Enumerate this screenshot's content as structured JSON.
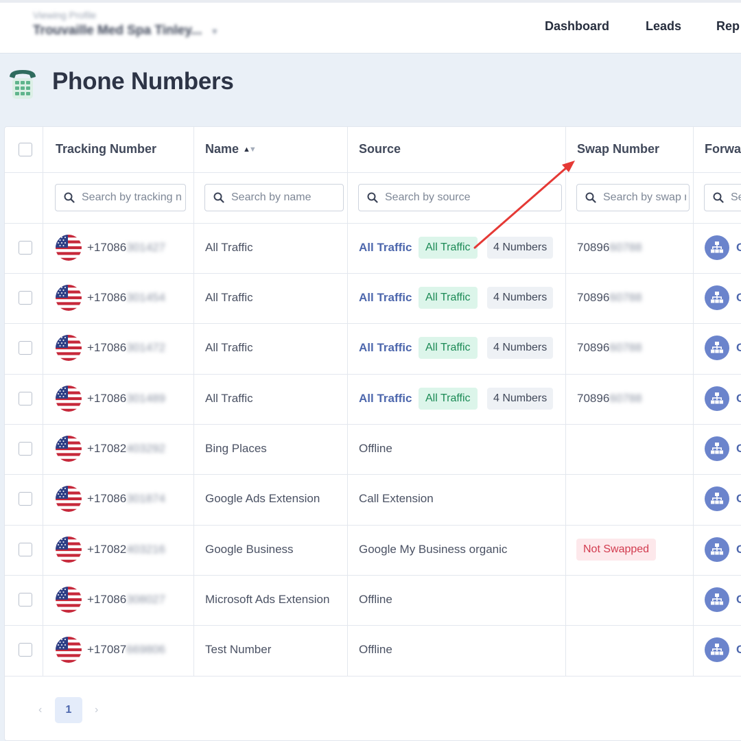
{
  "header": {
    "profile_label": "Viewing Profile",
    "profile_name": "Trouvaille Med Spa Tinley...",
    "nav": [
      "Dashboard",
      "Leads",
      "Rep"
    ]
  },
  "page_title": "Phone Numbers",
  "columns": [
    "Tracking Number",
    "Name",
    "Source",
    "Swap Number",
    "Forwa"
  ],
  "search": {
    "tracking": "Search by tracking n",
    "name": "Search by name",
    "source": "Search by source",
    "swap": "Search by swap r",
    "forward": "Se"
  },
  "rows": [
    {
      "num_prefix": "+17086",
      "num_rest": "301427",
      "name": "All Traffic",
      "source": "All Traffic",
      "source_tag": "All Traffic",
      "count_tag": "4 Numbers",
      "swap_prefix": "70896",
      "swap_rest": "60788",
      "swap_badge": "",
      "fwd": "C"
    },
    {
      "num_prefix": "+17086",
      "num_rest": "301454",
      "name": "All Traffic",
      "source": "All Traffic",
      "source_tag": "All Traffic",
      "count_tag": "4 Numbers",
      "swap_prefix": "70896",
      "swap_rest": "60788",
      "swap_badge": "",
      "fwd": "C"
    },
    {
      "num_prefix": "+17086",
      "num_rest": "301472",
      "name": "All Traffic",
      "source": "All Traffic",
      "source_tag": "All Traffic",
      "count_tag": "4 Numbers",
      "swap_prefix": "70896",
      "swap_rest": "60788",
      "swap_badge": "",
      "fwd": "C"
    },
    {
      "num_prefix": "+17086",
      "num_rest": "301489",
      "name": "All Traffic",
      "source": "All Traffic",
      "source_tag": "All Traffic",
      "count_tag": "4 Numbers",
      "swap_prefix": "70896",
      "swap_rest": "60788",
      "swap_badge": "",
      "fwd": "C"
    },
    {
      "num_prefix": "+17082",
      "num_rest": "403292",
      "name": "Bing Places",
      "source": "Offline",
      "source_tag": "",
      "count_tag": "",
      "swap_prefix": "",
      "swap_rest": "",
      "swap_badge": "",
      "fwd": "C"
    },
    {
      "num_prefix": "+17086",
      "num_rest": "301874",
      "name": "Google Ads Extension",
      "source": "Call Extension",
      "source_tag": "",
      "count_tag": "",
      "swap_prefix": "",
      "swap_rest": "",
      "swap_badge": "",
      "fwd": "C"
    },
    {
      "num_prefix": "+17082",
      "num_rest": "403216",
      "name": "Google Business",
      "source": "Google My Business organic",
      "source_tag": "",
      "count_tag": "",
      "swap_prefix": "",
      "swap_rest": "",
      "swap_badge": "Not Swapped",
      "fwd": "C"
    },
    {
      "num_prefix": "+17086",
      "num_rest": "308027",
      "name": "Microsoft Ads Extension",
      "source": "Offline",
      "source_tag": "",
      "count_tag": "",
      "swap_prefix": "",
      "swap_rest": "",
      "swap_badge": "",
      "fwd": "C"
    },
    {
      "num_prefix": "+17087",
      "num_rest": "669806",
      "name": "Test Number",
      "source": "Offline",
      "source_tag": "",
      "count_tag": "",
      "swap_prefix": "",
      "swap_rest": "",
      "swap_badge": "",
      "fwd": "C"
    }
  ],
  "pagination": {
    "prev": "‹",
    "current": "1",
    "next": "›"
  },
  "colors": {
    "accent": "#4d67ad",
    "tag_green_bg": "#dcf5ea",
    "tag_red_bg": "#fde8eb",
    "annotation_arrow": "#e53935"
  }
}
